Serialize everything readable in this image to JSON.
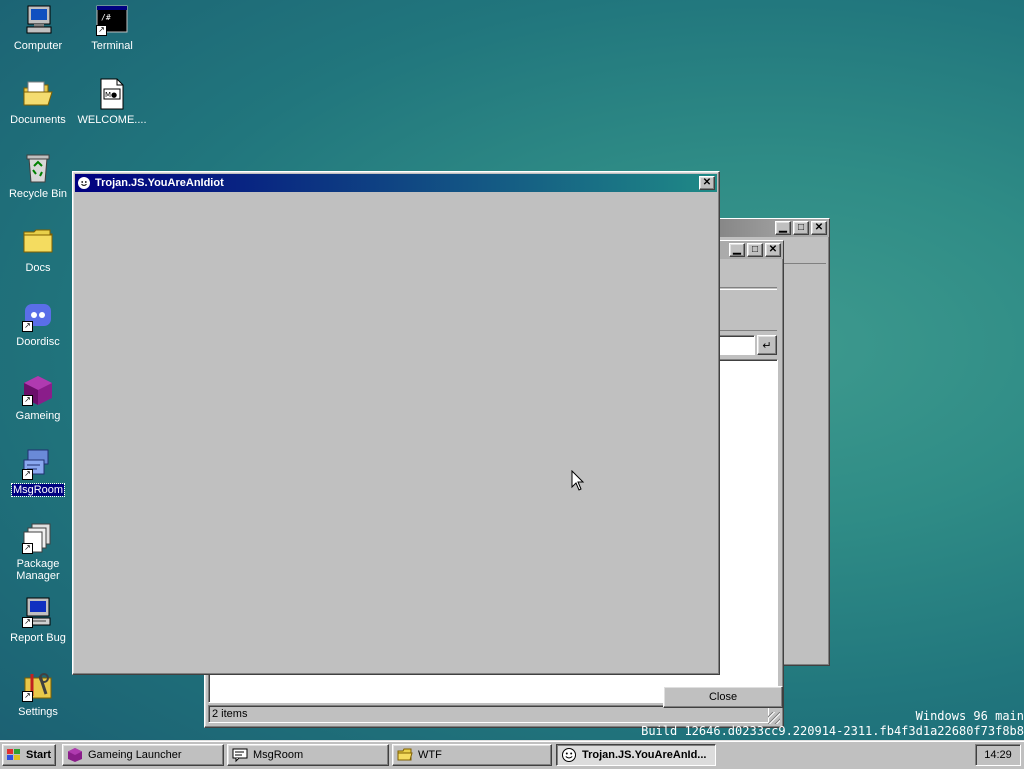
{
  "desktop": {
    "icons": [
      {
        "label": "Computer"
      },
      {
        "label": "Terminal"
      },
      {
        "label": "Documents"
      },
      {
        "label": "WELCOME...."
      },
      {
        "label": "Recycle Bin"
      },
      {
        "label": "Docs"
      },
      {
        "label": "Doordisc"
      },
      {
        "label": "Gameing"
      },
      {
        "label": "MsgRoom"
      },
      {
        "label": "Package Manager"
      },
      {
        "label": "Report Bug"
      },
      {
        "label": "Settings"
      }
    ],
    "terminal_icon_text": "/#",
    "welcome_icon_text": "M●",
    "watermark": {
      "line1": "Windows 96 main",
      "line2": "Build 12646.d0233cc9.220914-2311.fb4f3d1a22680f73f8b8"
    }
  },
  "trojan_window": {
    "title": "Trojan.JS.YouAreAnIdiot",
    "close_glyph": "✕"
  },
  "explorer_window": {
    "status": "2 items",
    "go_glyph": "↵"
  },
  "close_popup": {
    "label": "Close"
  },
  "taskbar": {
    "start_label": "Start",
    "tasks": [
      {
        "label": "Gameing Launcher"
      },
      {
        "label": "MsgRoom"
      },
      {
        "label": "WTF"
      },
      {
        "label": "Trojan.JS.YouAreAnId..."
      }
    ],
    "clock": "14:29"
  },
  "colors": {
    "titlebar_from": "#000080",
    "titlebar_to": "#1f8a86",
    "face": "#c0c0c0"
  }
}
